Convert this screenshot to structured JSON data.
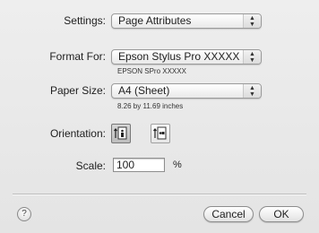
{
  "settings": {
    "label": "Settings:",
    "value": "Page Attributes"
  },
  "format_for": {
    "label": "Format For:",
    "value": "Epson Stylus Pro XXXXX",
    "subtext": "EPSON SPro XXXXX"
  },
  "paper_size": {
    "label": "Paper Size:",
    "value": "A4 (Sheet)",
    "subtext": "8.26 by 11.69 inches"
  },
  "orientation": {
    "label": "Orientation:",
    "options": [
      "portrait",
      "landscape"
    ],
    "selected": "portrait"
  },
  "scale": {
    "label": "Scale:",
    "value": "100",
    "unit": "%"
  },
  "buttons": {
    "help": "?",
    "cancel": "Cancel",
    "ok": "OK"
  },
  "colors": {
    "background": "#ececec",
    "divider": "#bdbdbd"
  }
}
